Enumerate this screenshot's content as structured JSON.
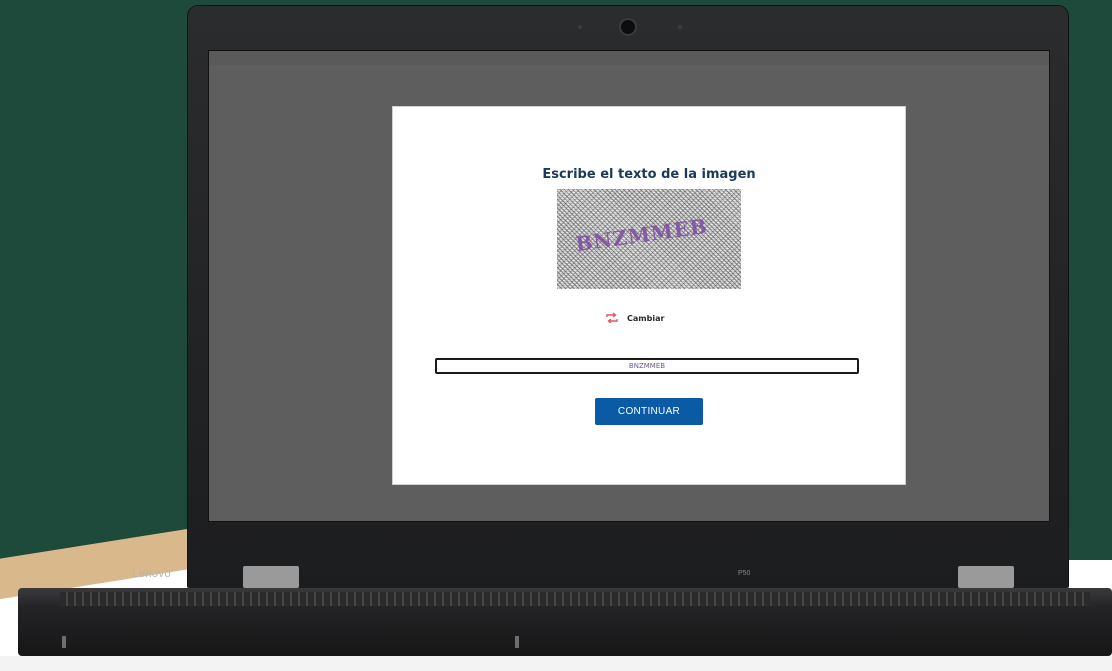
{
  "captcha_page": {
    "title": "Escribe el texto de la imagen",
    "captcha_text": "BNZMMEB",
    "refresh_label": "Cambiar",
    "input_value": "BNZMMEB",
    "continue_label": "CONTINUAR"
  },
  "laptop": {
    "brand": "Lenovo",
    "model": "P50"
  },
  "colors": {
    "background": "#1e4a3c",
    "accent_strip": "#d9b88c",
    "button": "#0a5aa6",
    "title": "#1b3a5a",
    "refresh_icon": "#e0556a",
    "captcha_text": "#7d4aa0"
  },
  "icons": {
    "refresh": "refresh-icon"
  }
}
